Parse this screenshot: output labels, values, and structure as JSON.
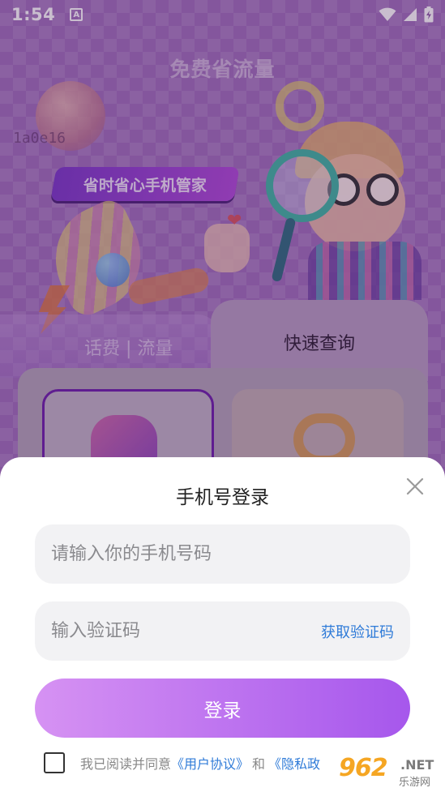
{
  "status_bar": {
    "time": "1:54",
    "notification_letter": "A"
  },
  "background_page": {
    "top_title": "免费省流量",
    "watermark_code": "1a0e16",
    "slogan": "省时省心手机管家",
    "tabs": [
      {
        "label": "话费 | 流量",
        "active": false
      },
      {
        "label": "快速查询",
        "active": true
      }
    ]
  },
  "login_sheet": {
    "title": "手机号登录",
    "phone_placeholder": "请输入你的手机号码",
    "code_placeholder": "输入验证码",
    "get_code_label": "获取验证码",
    "login_label": "登录",
    "agreement_prefix": "我已阅读并同意",
    "user_agreement": "《用户协议》",
    "and": "和",
    "privacy_policy": "《隐私政"
  },
  "site_watermark": {
    "number": "962",
    "suffix": ".NET",
    "name": "乐游网"
  },
  "colors": {
    "accent_link": "#2f7bd8",
    "login_gradient_start": "#d692f3",
    "login_gradient_end": "#a657ec",
    "background_purple": "#a070bb"
  },
  "icons": [
    "wifi-icon",
    "signal-icon",
    "battery-charging-icon",
    "close-icon",
    "phone-icon",
    "magnifier-icon",
    "heart-icon"
  ]
}
